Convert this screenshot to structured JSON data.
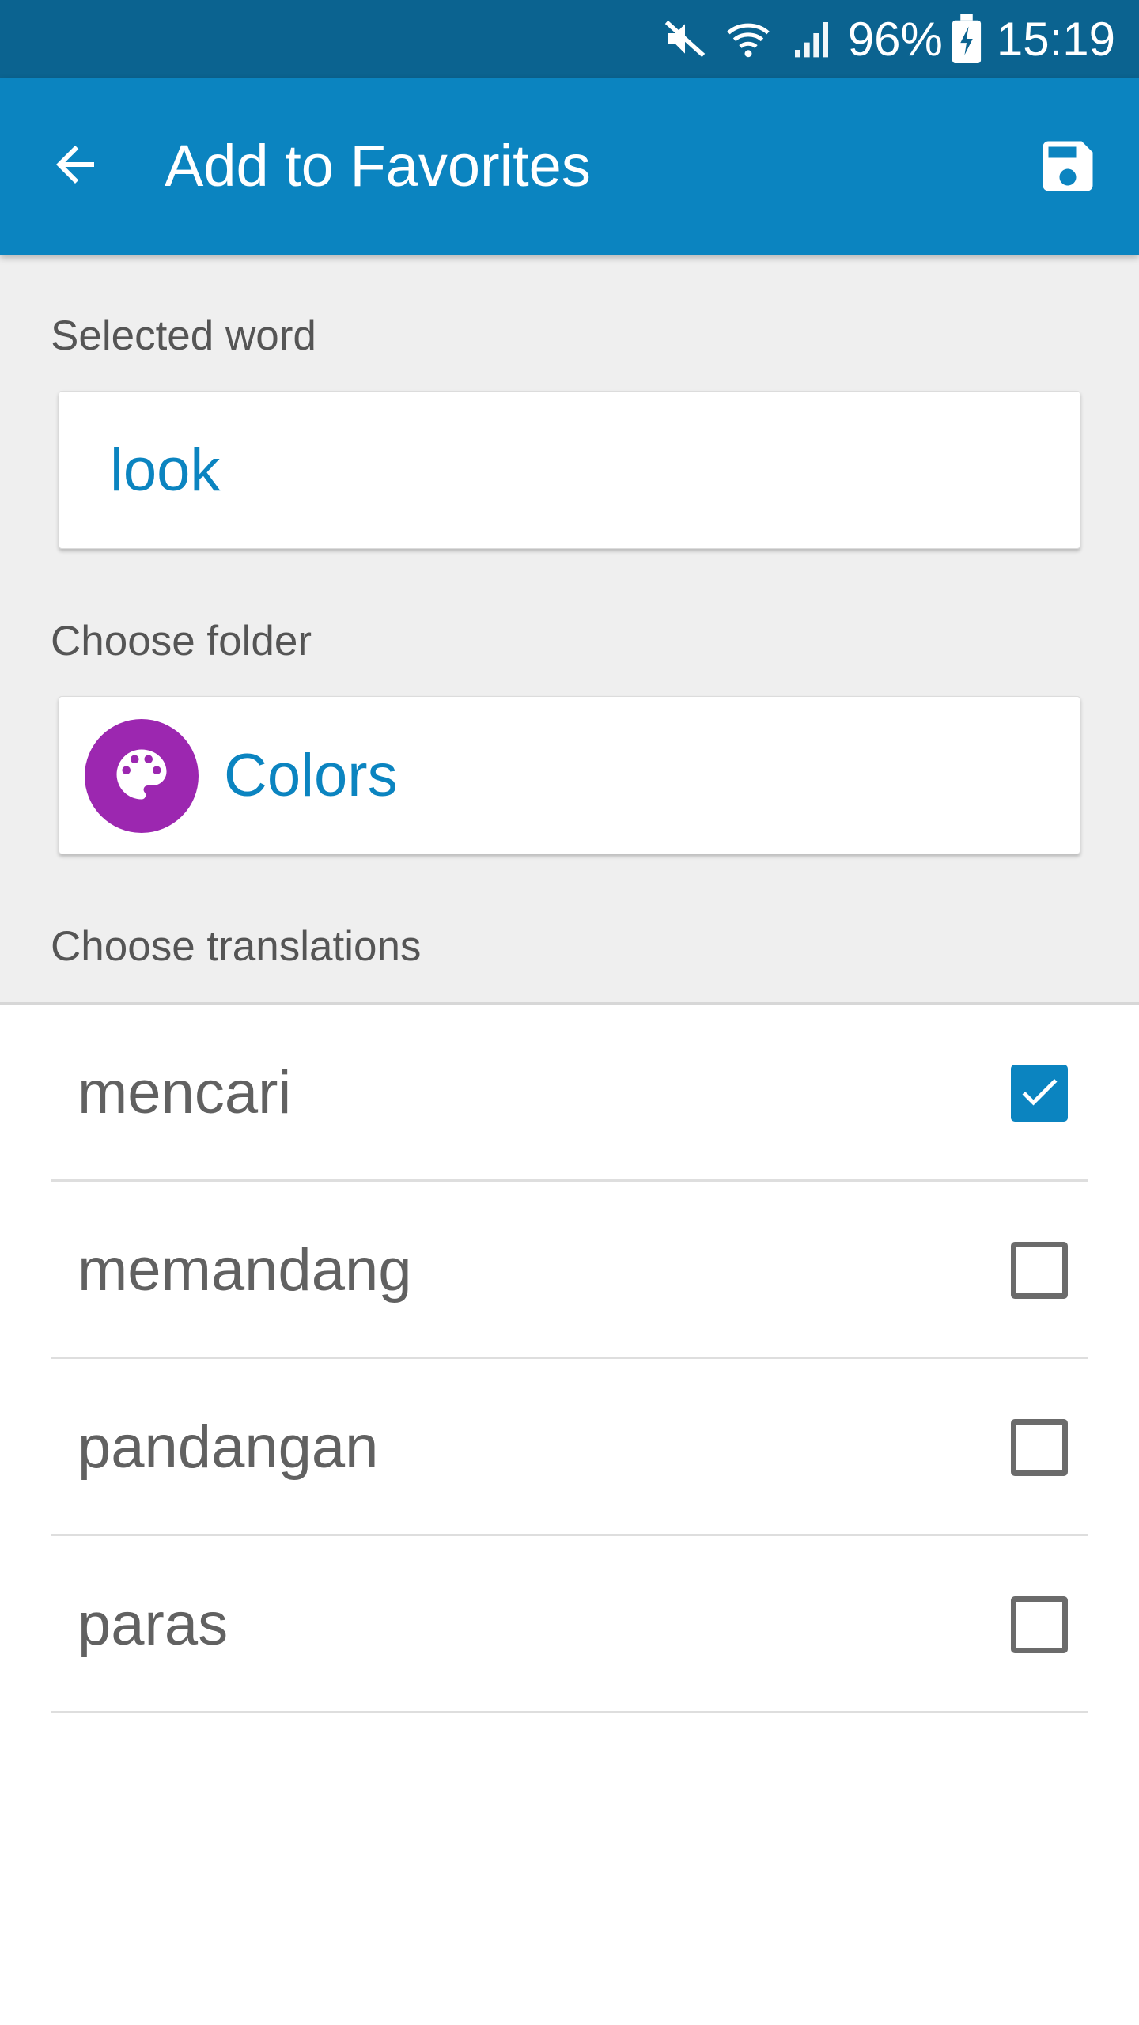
{
  "status_bar": {
    "icons": [
      "mute-icon",
      "wifi-icon",
      "signal-icon",
      "battery-charging-icon"
    ],
    "battery": "96%",
    "time": "15:19",
    "background_color": "#0b6390"
  },
  "app_bar": {
    "title": "Add to Favorites",
    "back_icon": "arrow-back-icon",
    "save_icon": "save-icon",
    "background_color": "#0b84c0"
  },
  "selected_word": {
    "label": "Selected word",
    "value": "look"
  },
  "folder": {
    "label": "Choose folder",
    "name": "Colors",
    "icon": "palette-icon",
    "avatar_color": "#9c27b0"
  },
  "translations": {
    "label": "Choose translations",
    "items": [
      {
        "text": "mencari",
        "checked": true
      },
      {
        "text": "memandang",
        "checked": false
      },
      {
        "text": "pandangan",
        "checked": false
      },
      {
        "text": "paras",
        "checked": false
      }
    ]
  }
}
